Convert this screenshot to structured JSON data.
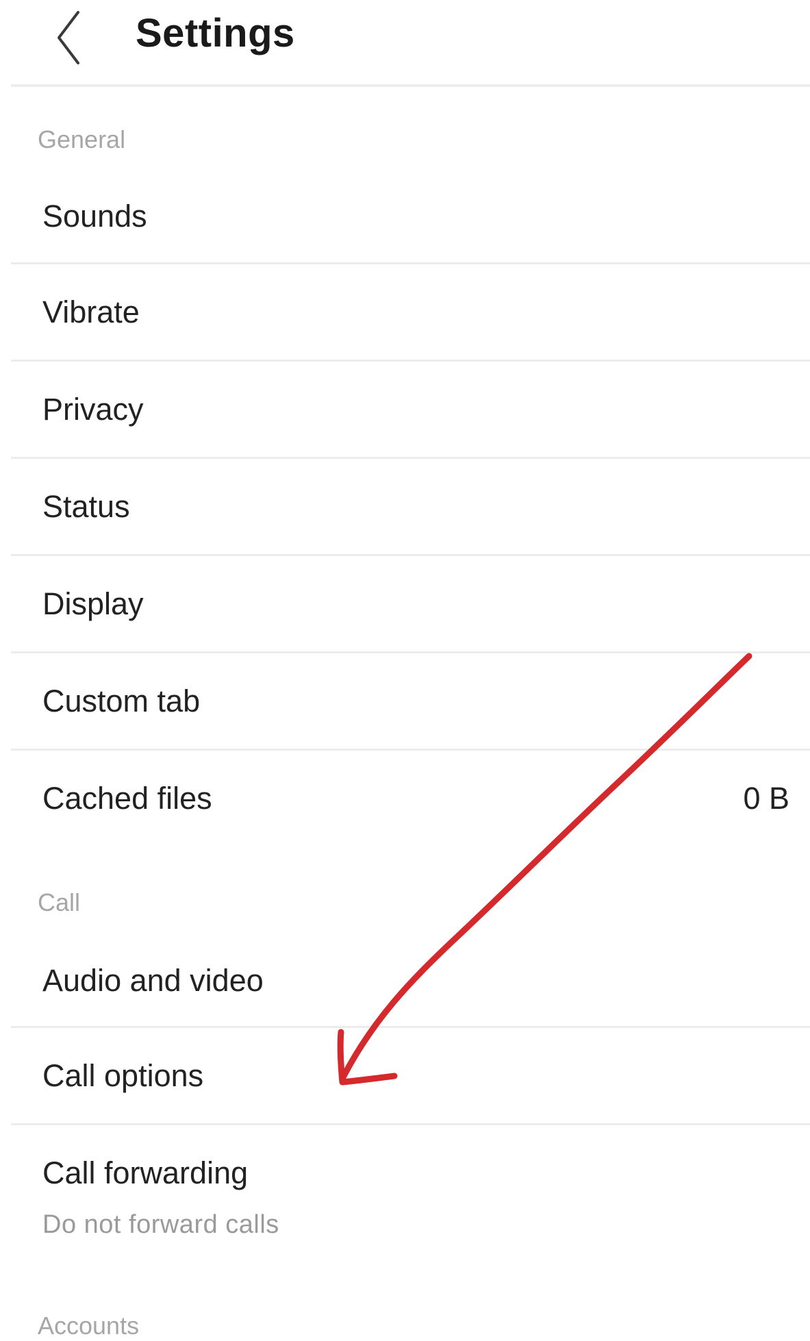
{
  "header": {
    "back_icon": "chevron-left-icon",
    "title": "Settings"
  },
  "sections": [
    {
      "header": "General",
      "items": [
        {
          "label": "Sounds"
        },
        {
          "label": "Vibrate"
        },
        {
          "label": "Privacy"
        },
        {
          "label": "Status"
        },
        {
          "label": "Display"
        },
        {
          "label": "Custom tab"
        },
        {
          "label": "Cached files",
          "value": "0 B"
        }
      ]
    },
    {
      "header": "Call",
      "items": [
        {
          "label": "Audio and video"
        },
        {
          "label": "Call options"
        },
        {
          "label": "Call forwarding",
          "subtitle": "Do not forward calls"
        }
      ]
    },
    {
      "header": "Accounts",
      "items": []
    }
  ],
  "annotation": {
    "type": "hand-drawn-arrow",
    "color": "#d42a2e",
    "points_to": "Call options"
  }
}
